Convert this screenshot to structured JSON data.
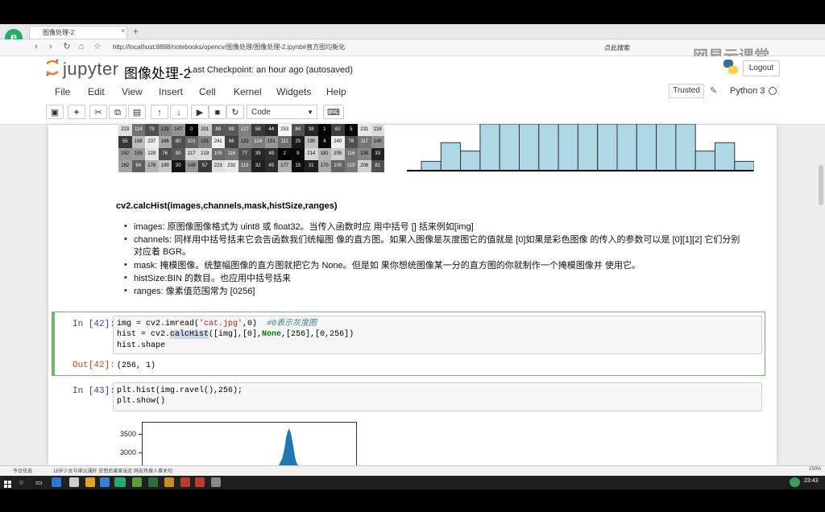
{
  "browser": {
    "tab_title": "图像处理-2",
    "url": "http://localhost:8888/notebooks/opencv/图像处理/图像处理-2.ipynb#直方图均衡化",
    "search_label": "点此搜索"
  },
  "watermark": "网易云课堂",
  "notebook": {
    "logo_text": "jupyter",
    "title": "图像处理-2",
    "checkpoint": "Last Checkpoint: an hour ago (autosaved)",
    "logout": "Logout",
    "trusted": "Trusted",
    "kernel": "Python 3",
    "cell_type": "Code",
    "menu": [
      "File",
      "Edit",
      "View",
      "Insert",
      "Cell",
      "Kernel",
      "Widgets",
      "Help"
    ]
  },
  "pixel_table": {
    "rows": [
      [
        "223",
        "114",
        "79",
        "129",
        "147",
        "0",
        "201",
        "88",
        "89",
        "127",
        "58",
        "44",
        "253",
        "84",
        "38",
        "1",
        "62",
        "5",
        "231",
        "218"
      ],
      [
        "55",
        "188",
        "237",
        "166",
        "80",
        "101",
        "131",
        "241",
        "66",
        "133",
        "124",
        "151",
        "111",
        "25",
        "190",
        "4",
        "240",
        "78",
        "117",
        "145"
      ],
      [
        "152",
        "155",
        "229",
        "76",
        "90",
        "217",
        "219",
        "105",
        "116",
        "77",
        "39",
        "49",
        "2",
        "9",
        "214",
        "181",
        "205",
        "116",
        "135",
        "33"
      ],
      [
        "162",
        "94",
        "178",
        "199",
        "20",
        "149",
        "57",
        "223",
        "232",
        "113",
        "32",
        "45",
        "177",
        "15",
        "31",
        "170",
        "100",
        "119",
        "208",
        "81"
      ]
    ]
  },
  "histogram_heights": [
    0.2,
    0.6,
    0.42,
    1.0,
    1.0,
    1.0,
    1.0,
    1.0,
    1.0,
    1.0,
    1.0,
    1.0,
    1.0,
    1.0,
    0.42,
    0.6,
    0.2
  ],
  "markdown": {
    "heading": "cv2.calcHist(images,channels,mask,histSize,ranges)",
    "bullets": [
      "images: 原图像图像格式为 uint8 或 float32。当传入函数时应 用中括号 [] 括来例如[img]",
      "channels: 同样用中括号括来它会告函数我们统幅图 像的直方图。如果入图像是灰度图它的值就是 [0]如果是彩色图像 的传入的参数可以是 [0][1][2] 它们分别",
      "对应着 BGR。",
      "mask: 掩模图像。统整幅图像的直方图就把它为 None。但是如 果你想统图像某一分的直方图的你就制作一个掩模图像并 使用它。",
      "histSize:BIN 的数目。也应用中括号括来",
      "ranges: 像素值范围常为 [0256]"
    ]
  },
  "cell42": {
    "in_prompt": "In [42]:",
    "out_prompt": "Out[42]:",
    "line1_pre": "img = cv2.imread(",
    "line1_str": "'cat.jpg'",
    "line1_mid": ",0)  ",
    "line1_comment": "#0表示灰度图",
    "line2_pre": "hist = cv2.",
    "line2_fn": "calcHist",
    "line2_post": "([img],[0],",
    "line2_kw": "None",
    "line2_end": ",[256],[0,256])",
    "line3": "hist.shape",
    "output": "(256, 1)"
  },
  "cell43": {
    "in_prompt": "In [43]:",
    "line1": "plt.hist(img.ravel(),256);",
    "line2": "plt.show()",
    "ytick_top": "3500",
    "ytick_bottom": "3000"
  },
  "status": {
    "left": "今日优选",
    "news": "18岁少女与继父通奸  狂怒后离家出走  网友热搜人事关切",
    "zoom": "150%",
    "clock": "23:43"
  }
}
